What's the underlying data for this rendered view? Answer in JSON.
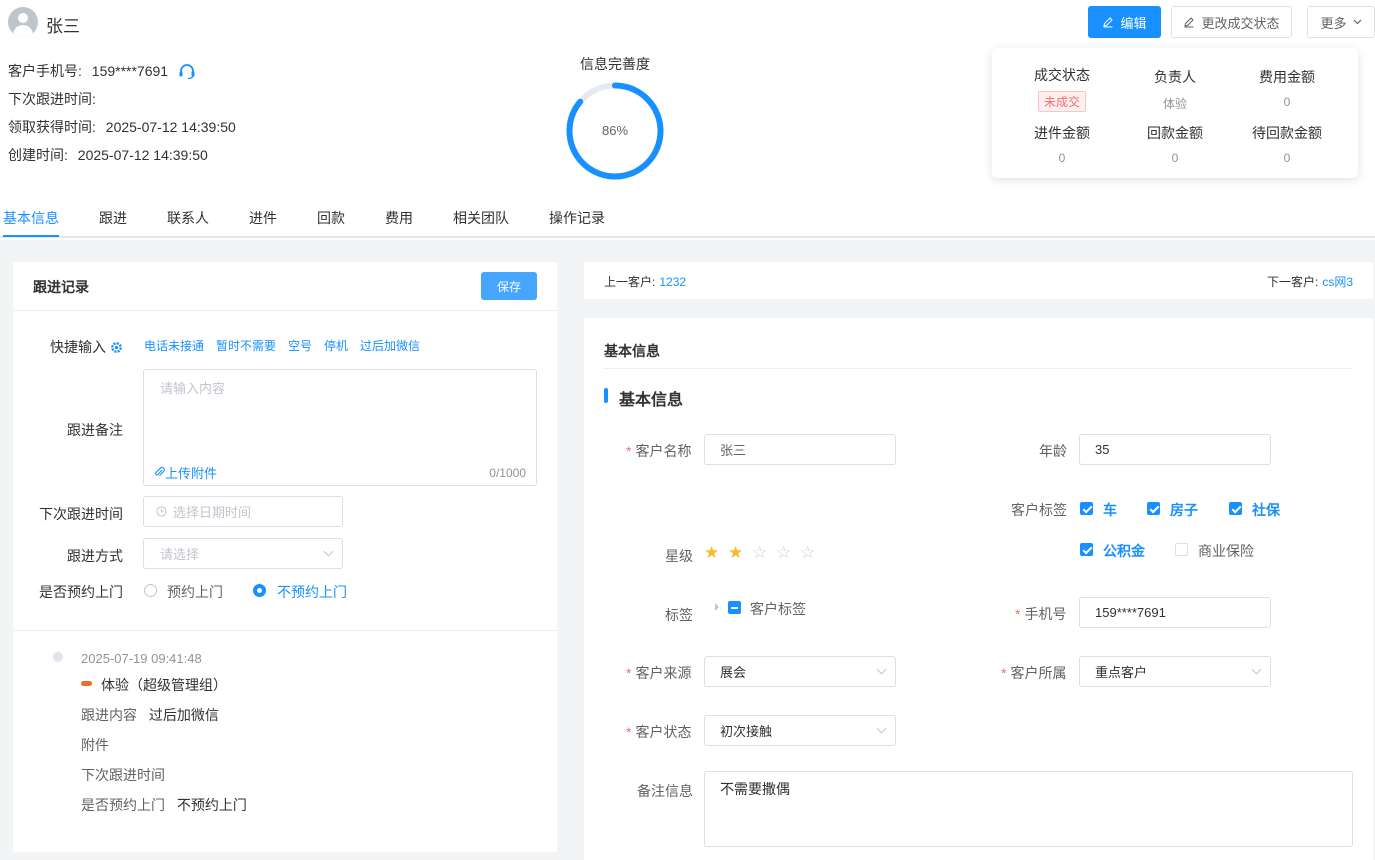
{
  "header": {
    "customer_name": "张三",
    "phone_label": "客户手机号:",
    "phone_value": "159****7691",
    "next_follow_label": "下次跟进时间:",
    "claim_time_label": "领取获得时间:",
    "claim_time_value": "2025-07-12 14:39:50",
    "created_label": "创建时间:",
    "created_value": "2025-07-12 14:39:50",
    "buttons": {
      "edit": "编辑",
      "change_status": "更改成交状态",
      "more": "更多"
    }
  },
  "completeness": {
    "title": "信息完善度",
    "percent_text": "86%",
    "percent": 86
  },
  "stats": {
    "deal_status_label": "成交状态",
    "deal_status_value": "未成交",
    "owner_label": "负责人",
    "owner_value": "体验",
    "fee_label": "费用金额",
    "fee_value": "0",
    "income_label": "进件金额",
    "income_value": "0",
    "refund_label": "回款金额",
    "refund_value": "0",
    "pending_refund_label": "待回款金额",
    "pending_refund_value": "0"
  },
  "tabs": [
    "基本信息",
    "跟进",
    "联系人",
    "进件",
    "回款",
    "费用",
    "相关团队",
    "操作记录"
  ],
  "follow": {
    "title": "跟进记录",
    "save": "保存",
    "quick_input_label": "快捷输入",
    "quick_items": [
      "电话未接通",
      "暂时不需要",
      "空号",
      "停机",
      "过后加微信"
    ],
    "remark_label": "跟进备注",
    "remark_placeholder": "请输入内容",
    "upload": "上传附件",
    "counter": "0/1000",
    "next_time_label": "下次跟进时间",
    "next_time_placeholder": "选择日期时间",
    "method_label": "跟进方式",
    "method_placeholder": "请选择",
    "visit_label": "是否预约上门",
    "visit_opt1": "预约上门",
    "visit_opt2": "不预约上门"
  },
  "timeline": {
    "time": "2025-07-19 09:41:48",
    "user": "体验（超级管理组）",
    "content_label": "跟进内容",
    "content_value": "过后加微信",
    "attach_label": "附件",
    "next_label": "下次跟进时间",
    "visit_label": "是否预约上门",
    "visit_value": "不预约上门"
  },
  "nav": {
    "prev_label": "上一客户:",
    "prev_value": "1232",
    "next_label": "下一客户:",
    "next_value": "cs网3"
  },
  "basic": {
    "panel_title": "基本信息",
    "section_title": "基本信息",
    "name_label": "客户名称",
    "name_value": "张三",
    "age_label": "年龄",
    "age_value": "35",
    "tags_label": "客户标签",
    "tags": [
      {
        "label": "车",
        "checked": true
      },
      {
        "label": "房子",
        "checked": true
      },
      {
        "label": "社保",
        "checked": true
      },
      {
        "label": "公积金",
        "checked": true
      },
      {
        "label": "商业保险",
        "checked": false
      }
    ],
    "star_label": "星级",
    "stars": 2,
    "stars_max": 5,
    "tag_label": "标签",
    "tag_tree_label": "客户标签",
    "phone_label": "手机号",
    "phone_value": "159****7691",
    "source_label": "客户来源",
    "source_value": "展会",
    "belong_label": "客户所属",
    "belong_value": "重点客户",
    "status_label": "客户状态",
    "status_value": "初次接触",
    "note_label": "备注信息",
    "note_value": "不需要撒偶"
  },
  "colors": {
    "primary": "#1890ff",
    "danger": "#f56c6c",
    "star": "#f7ba2a",
    "accent_orange": "#ee6d2b"
  }
}
